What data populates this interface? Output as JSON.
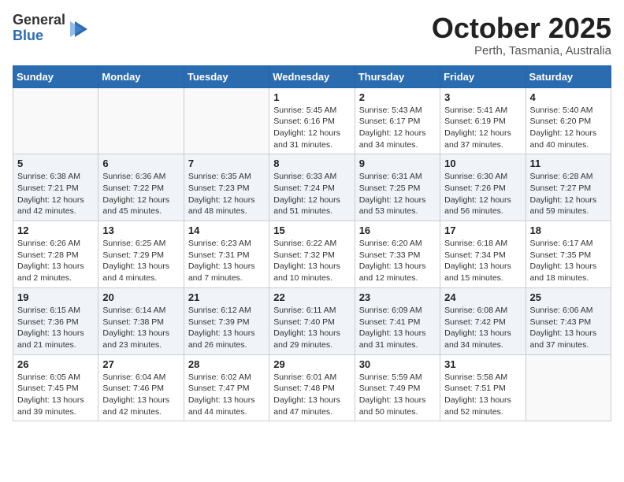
{
  "logo": {
    "general": "General",
    "blue": "Blue"
  },
  "header": {
    "month": "October 2025",
    "location": "Perth, Tasmania, Australia"
  },
  "weekdays": [
    "Sunday",
    "Monday",
    "Tuesday",
    "Wednesday",
    "Thursday",
    "Friday",
    "Saturday"
  ],
  "weeks": [
    [
      {
        "day": "",
        "info": ""
      },
      {
        "day": "",
        "info": ""
      },
      {
        "day": "",
        "info": ""
      },
      {
        "day": "1",
        "info": "Sunrise: 5:45 AM\nSunset: 6:16 PM\nDaylight: 12 hours\nand 31 minutes."
      },
      {
        "day": "2",
        "info": "Sunrise: 5:43 AM\nSunset: 6:17 PM\nDaylight: 12 hours\nand 34 minutes."
      },
      {
        "day": "3",
        "info": "Sunrise: 5:41 AM\nSunset: 6:19 PM\nDaylight: 12 hours\nand 37 minutes."
      },
      {
        "day": "4",
        "info": "Sunrise: 5:40 AM\nSunset: 6:20 PM\nDaylight: 12 hours\nand 40 minutes."
      }
    ],
    [
      {
        "day": "5",
        "info": "Sunrise: 6:38 AM\nSunset: 7:21 PM\nDaylight: 12 hours\nand 42 minutes."
      },
      {
        "day": "6",
        "info": "Sunrise: 6:36 AM\nSunset: 7:22 PM\nDaylight: 12 hours\nand 45 minutes."
      },
      {
        "day": "7",
        "info": "Sunrise: 6:35 AM\nSunset: 7:23 PM\nDaylight: 12 hours\nand 48 minutes."
      },
      {
        "day": "8",
        "info": "Sunrise: 6:33 AM\nSunset: 7:24 PM\nDaylight: 12 hours\nand 51 minutes."
      },
      {
        "day": "9",
        "info": "Sunrise: 6:31 AM\nSunset: 7:25 PM\nDaylight: 12 hours\nand 53 minutes."
      },
      {
        "day": "10",
        "info": "Sunrise: 6:30 AM\nSunset: 7:26 PM\nDaylight: 12 hours\nand 56 minutes."
      },
      {
        "day": "11",
        "info": "Sunrise: 6:28 AM\nSunset: 7:27 PM\nDaylight: 12 hours\nand 59 minutes."
      }
    ],
    [
      {
        "day": "12",
        "info": "Sunrise: 6:26 AM\nSunset: 7:28 PM\nDaylight: 13 hours\nand 2 minutes."
      },
      {
        "day": "13",
        "info": "Sunrise: 6:25 AM\nSunset: 7:29 PM\nDaylight: 13 hours\nand 4 minutes."
      },
      {
        "day": "14",
        "info": "Sunrise: 6:23 AM\nSunset: 7:31 PM\nDaylight: 13 hours\nand 7 minutes."
      },
      {
        "day": "15",
        "info": "Sunrise: 6:22 AM\nSunset: 7:32 PM\nDaylight: 13 hours\nand 10 minutes."
      },
      {
        "day": "16",
        "info": "Sunrise: 6:20 AM\nSunset: 7:33 PM\nDaylight: 13 hours\nand 12 minutes."
      },
      {
        "day": "17",
        "info": "Sunrise: 6:18 AM\nSunset: 7:34 PM\nDaylight: 13 hours\nand 15 minutes."
      },
      {
        "day": "18",
        "info": "Sunrise: 6:17 AM\nSunset: 7:35 PM\nDaylight: 13 hours\nand 18 minutes."
      }
    ],
    [
      {
        "day": "19",
        "info": "Sunrise: 6:15 AM\nSunset: 7:36 PM\nDaylight: 13 hours\nand 21 minutes."
      },
      {
        "day": "20",
        "info": "Sunrise: 6:14 AM\nSunset: 7:38 PM\nDaylight: 13 hours\nand 23 minutes."
      },
      {
        "day": "21",
        "info": "Sunrise: 6:12 AM\nSunset: 7:39 PM\nDaylight: 13 hours\nand 26 minutes."
      },
      {
        "day": "22",
        "info": "Sunrise: 6:11 AM\nSunset: 7:40 PM\nDaylight: 13 hours\nand 29 minutes."
      },
      {
        "day": "23",
        "info": "Sunrise: 6:09 AM\nSunset: 7:41 PM\nDaylight: 13 hours\nand 31 minutes."
      },
      {
        "day": "24",
        "info": "Sunrise: 6:08 AM\nSunset: 7:42 PM\nDaylight: 13 hours\nand 34 minutes."
      },
      {
        "day": "25",
        "info": "Sunrise: 6:06 AM\nSunset: 7:43 PM\nDaylight: 13 hours\nand 37 minutes."
      }
    ],
    [
      {
        "day": "26",
        "info": "Sunrise: 6:05 AM\nSunset: 7:45 PM\nDaylight: 13 hours\nand 39 minutes."
      },
      {
        "day": "27",
        "info": "Sunrise: 6:04 AM\nSunset: 7:46 PM\nDaylight: 13 hours\nand 42 minutes."
      },
      {
        "day": "28",
        "info": "Sunrise: 6:02 AM\nSunset: 7:47 PM\nDaylight: 13 hours\nand 44 minutes."
      },
      {
        "day": "29",
        "info": "Sunrise: 6:01 AM\nSunset: 7:48 PM\nDaylight: 13 hours\nand 47 minutes."
      },
      {
        "day": "30",
        "info": "Sunrise: 5:59 AM\nSunset: 7:49 PM\nDaylight: 13 hours\nand 50 minutes."
      },
      {
        "day": "31",
        "info": "Sunrise: 5:58 AM\nSunset: 7:51 PM\nDaylight: 13 hours\nand 52 minutes."
      },
      {
        "day": "",
        "info": ""
      }
    ]
  ]
}
